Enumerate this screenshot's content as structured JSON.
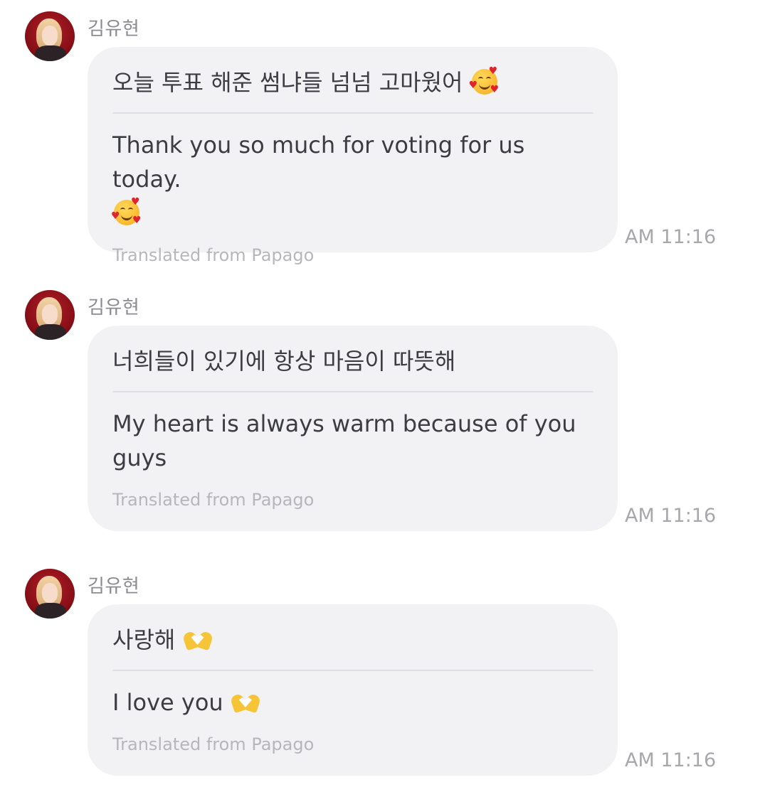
{
  "messages": [
    {
      "sender": "김유현",
      "original": "오늘 투표 해준 썸냐들 넘넘 고마웠어",
      "original_emoji": "smiling-face-with-hearts-icon",
      "translated": "Thank you so much for voting for us today.",
      "translated_emoji": "smiling-face-with-hearts-icon",
      "credit": "Translated from Papago",
      "time": "AM 11:16"
    },
    {
      "sender": "김유현",
      "original": "너희들이 있기에 항상 마음이 따뜻해",
      "translated": "My heart is always warm because of you guys",
      "credit": "Translated from Papago",
      "time": "AM 11:16"
    },
    {
      "sender": "김유현",
      "original": "사랑해",
      "original_emoji": "heart-hands-icon",
      "translated": "I love you",
      "translated_emoji": "heart-hands-icon",
      "credit": "Translated from Papago",
      "time": "AM 11:16"
    }
  ]
}
